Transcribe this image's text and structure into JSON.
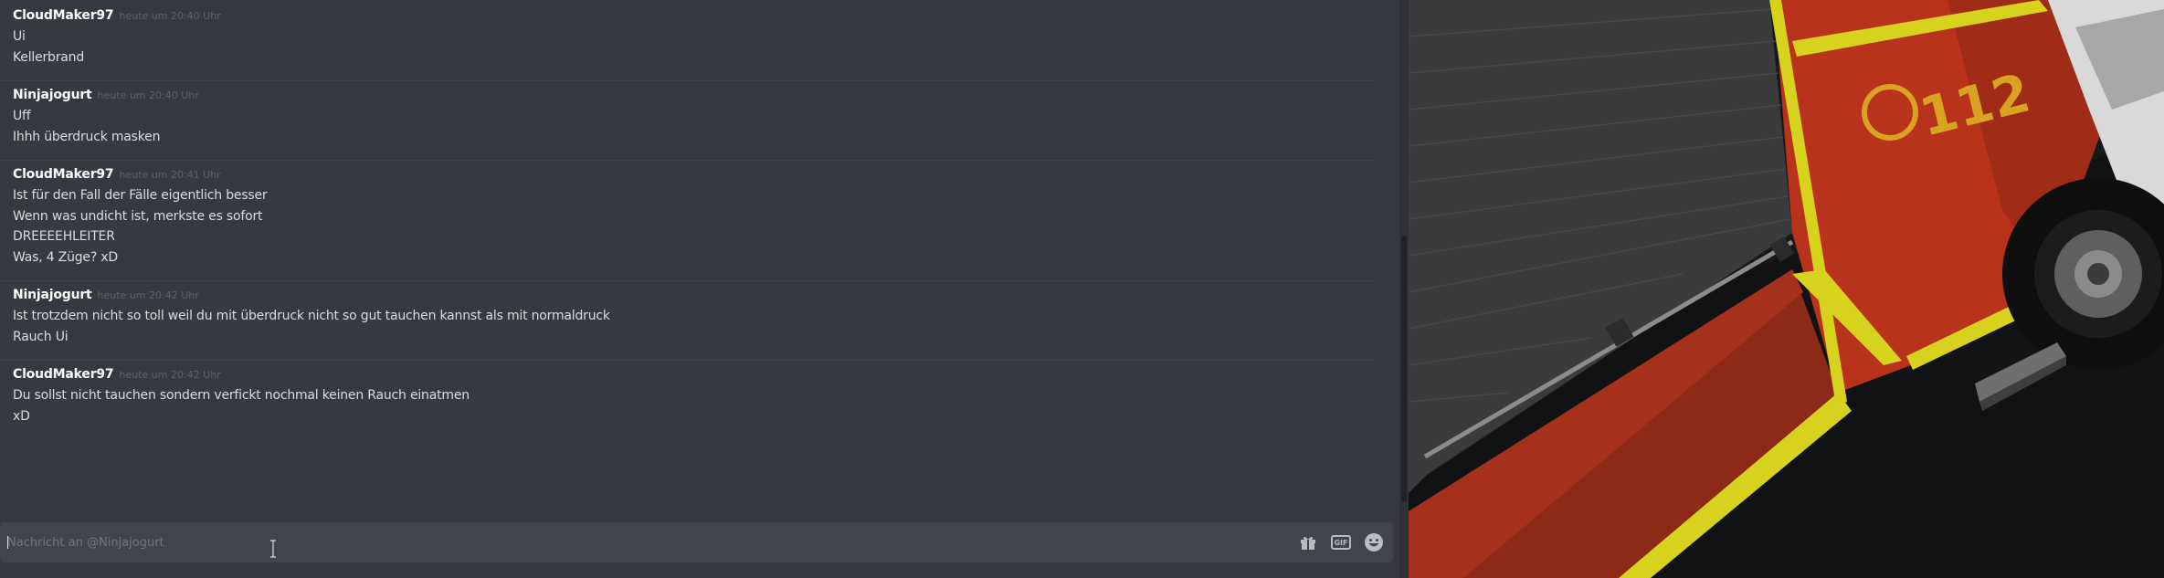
{
  "messages": [
    {
      "author": "CloudMaker97",
      "time": "heute um 20:40 Uhr",
      "lines": [
        "Ui",
        "Kellerbrand"
      ]
    },
    {
      "author": "Ninjajogurt",
      "time": "heute um 20:40 Uhr",
      "lines": [
        "Uff",
        "Ihhh überdruck masken"
      ]
    },
    {
      "author": "CloudMaker97",
      "time": "heute um 20:41 Uhr",
      "lines": [
        "Ist für den Fall der Fälle eigentlich besser",
        "Wenn was undicht ist, merkste es sofort",
        "DREEEEHLEITER",
        "Was, 4 Züge? xD"
      ]
    },
    {
      "author": "Ninjajogurt",
      "time": "heute um 20:42 Uhr",
      "lines": [
        "Ist trotzdem nicht so toll weil du mit überdruck nicht so gut tauchen kannst als mit normaldruck",
        "Rauch Ui"
      ]
    },
    {
      "author": "CloudMaker97",
      "time": "heute um 20:42 Uhr",
      "lines": [
        "Du sollst nicht tauchen sondern verfickt nochmal keinen Rauch einatmen",
        "xD"
      ]
    }
  ],
  "composer": {
    "placeholder": "Nachricht an @Ninjajogurt",
    "value": "",
    "icons": [
      "gift-icon",
      "gif-icon",
      "emoji-icon"
    ],
    "gif_label": "GIF"
  },
  "media": {
    "vehicle_number": "112",
    "icon": "fire-truck-image"
  },
  "colors": {
    "background": "#36393f",
    "input": "#40444b",
    "username": "#ffffff",
    "text": "#dcddde",
    "timestamp": "#5e6168",
    "truck_red": "#b8321c",
    "truck_yellow": "#d6d21e"
  }
}
